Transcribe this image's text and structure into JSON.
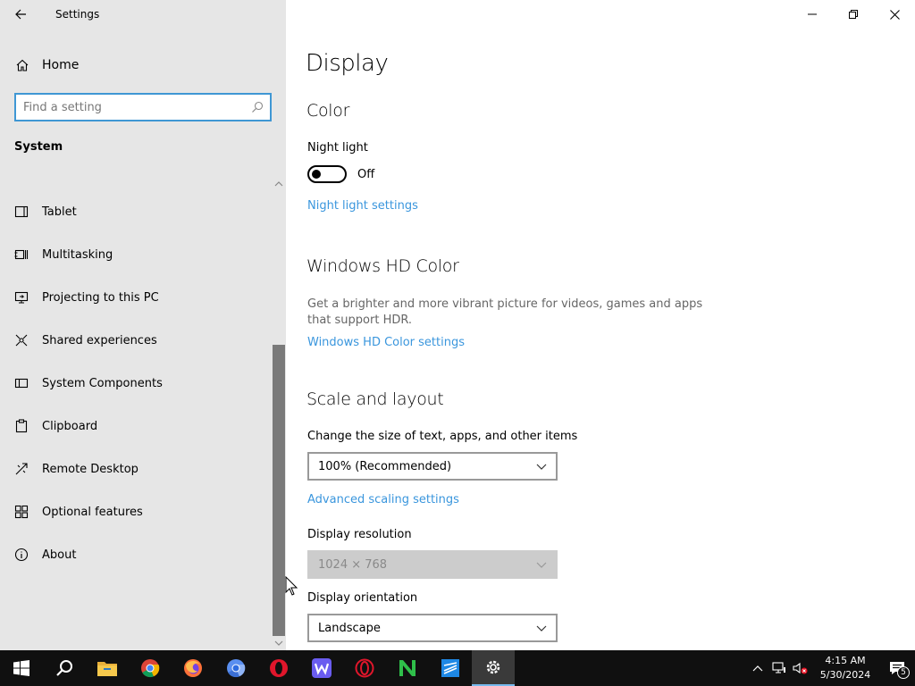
{
  "window": {
    "title": "Settings",
    "controls": [
      "minimize-icon",
      "restore-icon",
      "close-icon"
    ]
  },
  "sidebar": {
    "home_label": "Home",
    "search_placeholder": "Find a setting",
    "section_title": "System",
    "items": [
      {
        "label": "Tablet",
        "icon": "tablet-icon"
      },
      {
        "label": "Multitasking",
        "icon": "multitasking-icon"
      },
      {
        "label": "Projecting to this PC",
        "icon": "projecting-icon"
      },
      {
        "label": "Shared experiences",
        "icon": "shared-experiences-icon"
      },
      {
        "label": "System Components",
        "icon": "system-components-icon"
      },
      {
        "label": "Clipboard",
        "icon": "clipboard-icon"
      },
      {
        "label": "Remote Desktop",
        "icon": "remote-desktop-icon"
      },
      {
        "label": "Optional features",
        "icon": "optional-features-icon"
      },
      {
        "label": "About",
        "icon": "info-icon"
      }
    ]
  },
  "main": {
    "page_title": "Display",
    "color": {
      "heading": "Color",
      "night_light_label": "Night light",
      "night_light_state": "Off",
      "night_light_link": "Night light settings"
    },
    "hd_color": {
      "heading": "Windows HD Color",
      "description": "Get a brighter and more vibrant picture for videos, games and apps that support HDR.",
      "link": "Windows HD Color settings"
    },
    "scale": {
      "heading": "Scale and layout",
      "size_label": "Change the size of text, apps, and other items",
      "size_value": "100% (Recommended)",
      "advanced_link": "Advanced scaling settings",
      "resolution_label": "Display resolution",
      "resolution_value": "1024 × 768",
      "orientation_label": "Display orientation",
      "orientation_value": "Landscape"
    }
  },
  "taskbar": {
    "apps": [
      "windows-start-icon",
      "search-icon",
      "file-explorer-icon",
      "chrome-icon",
      "firefox-icon",
      "chromium-icon",
      "opera-icon",
      "app-w-icon",
      "opera-gx-icon",
      "app-n-icon",
      "app-s-icon",
      "settings-icon"
    ],
    "time": "4:15 AM",
    "date": "5/30/2024",
    "notification_count": "5"
  },
  "colors": {
    "accent": "#3a96dd",
    "sidebar_bg": "#e6e6e6",
    "taskbar_bg": "#101010"
  }
}
